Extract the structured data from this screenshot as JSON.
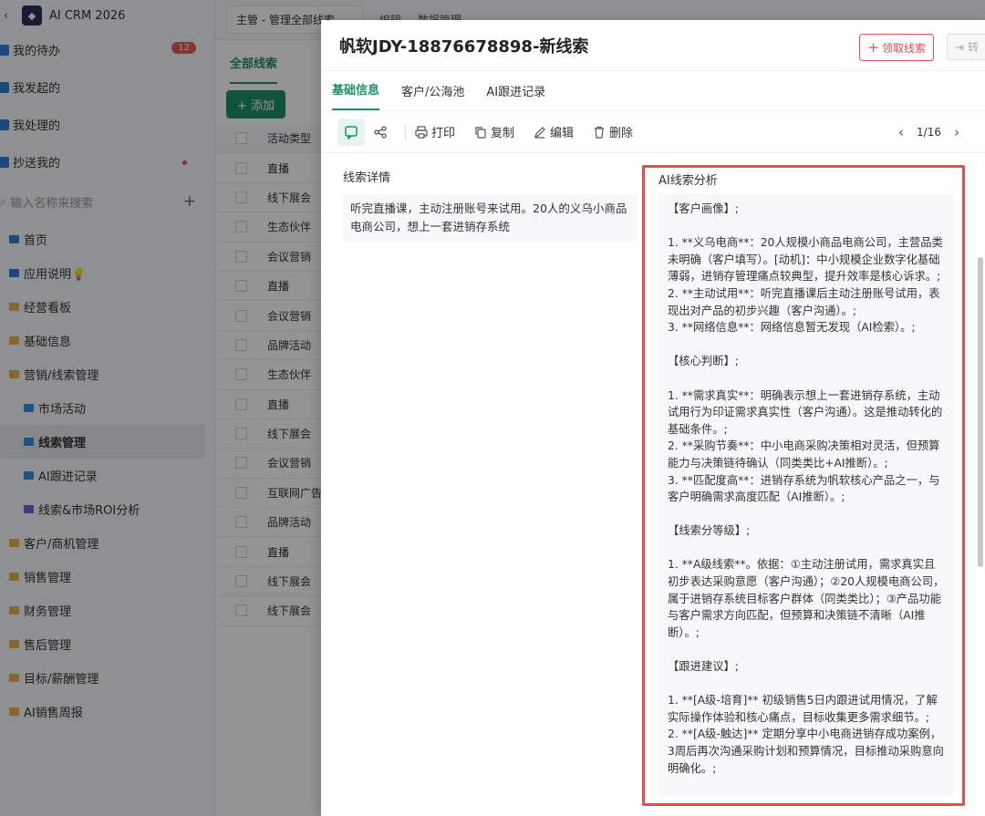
{
  "app": {
    "title": "AI CRM 2026",
    "back_glyph": "‹",
    "logo_glyph": "◆"
  },
  "sidebar": {
    "top_items": [
      {
        "label": "我的待办",
        "badge": "12",
        "color": "#2f7ed8"
      },
      {
        "label": "我发起的",
        "color": "#2f7ed8"
      },
      {
        "label": "我处理的",
        "color": "#2f7ed8"
      },
      {
        "label": "抄送我的",
        "color": "#2f7ed8"
      }
    ],
    "search_placeholder": "输入名称来搜索",
    "nav_items": [
      {
        "label": "首页"
      },
      {
        "label": "应用说明💡"
      },
      {
        "label": "经营看板"
      },
      {
        "label": "基础信息"
      },
      {
        "label": "营销/线索管理"
      },
      {
        "label": "市场活动"
      },
      {
        "label": "线索管理"
      },
      {
        "label": "AI跟进记录"
      },
      {
        "label": "线索&市场ROI分析"
      },
      {
        "label": "客户/商机管理"
      },
      {
        "label": "销售管理"
      },
      {
        "label": "财务管理"
      },
      {
        "label": "售后管理"
      },
      {
        "label": "目标/薪酬管理"
      },
      {
        "label": "AI销售周报"
      }
    ]
  },
  "topbar": {
    "view_select": "主管 - 管理全部线索",
    "edit": "编辑",
    "data_manage": "数据管理"
  },
  "list": {
    "tab": "全部线索",
    "add_button": "+ 添加",
    "column_header": "活动类型",
    "rows": [
      "直播",
      "线下展会",
      "生态伙伴",
      "会议营销",
      "直播",
      "会议营销",
      "品牌活动",
      "生态伙伴",
      "直播",
      "线下展会",
      "会议营销",
      "互联网广告",
      "品牌活动",
      "直播",
      "线下展会",
      "线下展会"
    ]
  },
  "drawer": {
    "title": "帆软JDY-18876678898-新线索",
    "claim_button": "领取线索",
    "convert_button": "转",
    "tabs": [
      "基础信息",
      "客户/公海池",
      "AI跟进记录"
    ],
    "toolbar": {
      "print": "打印",
      "copy": "复制",
      "edit": "编辑",
      "delete": "删除",
      "page": "1/16"
    },
    "detail_label": "线索详情",
    "detail_text": "听完直播课，主动注册账号来试用。20人的义乌小商品电商公司，想上一套进销存系统",
    "ai_label": "AI线索分析",
    "ai_lines": [
      "【客户画像】;",
      "",
      "1. **义乌电商**：20人规模小商品电商公司，主营品类未明确（客户填写）。[动机]：中小规模企业数字化基础薄弱，进销存管理痛点较典型，提升效率是核心诉求。;",
      "2. **主动试用**：听完直播课后主动注册账号试用，表现出对产品的初步兴趣（客户沟通）。;",
      "3. **网络信息**：网络信息暂无发现（AI检索）。;",
      "",
      "【核心判断】;",
      "",
      "1. **需求真实**：明确表示想上一套进销存系统，主动试用行为印证需求真实性（客户沟通）。这是推动转化的基础条件。;",
      "2. **采购节奏**：中小电商采购决策相对灵活，但预算能力与决策链待确认（同类类比+AI推断）。;",
      "3. **匹配度高**：进销存系统为帆软核心产品之一，与客户明确需求高度匹配（AI推断）。;",
      "",
      "【线索分等级】;",
      "",
      "1. **A级线索**。依据：①主动注册试用，需求真实且初步表达采购意愿（客户沟通）；②20人规模电商公司，属于进销存系统目标客户群体（同类类比）；③产品功能与客户需求方向匹配，但预算和决策链不清晰（AI推断）。;",
      "",
      "【跟进建议】;",
      "",
      "1. **[A级-培育]** 初级销售5日内跟进试用情况，了解实际操作体验和核心痛点，目标收集更多需求细节。;",
      "2. **[A级-触达]** 定期分享中小电商进销存成功案例，3周后再次沟通采购计划和预算情况，目标推动采购意向明确化。;"
    ]
  },
  "colors": {
    "accent": "#1f8f6a",
    "danger": "#e34d4d",
    "badge": "#e65a5a"
  }
}
